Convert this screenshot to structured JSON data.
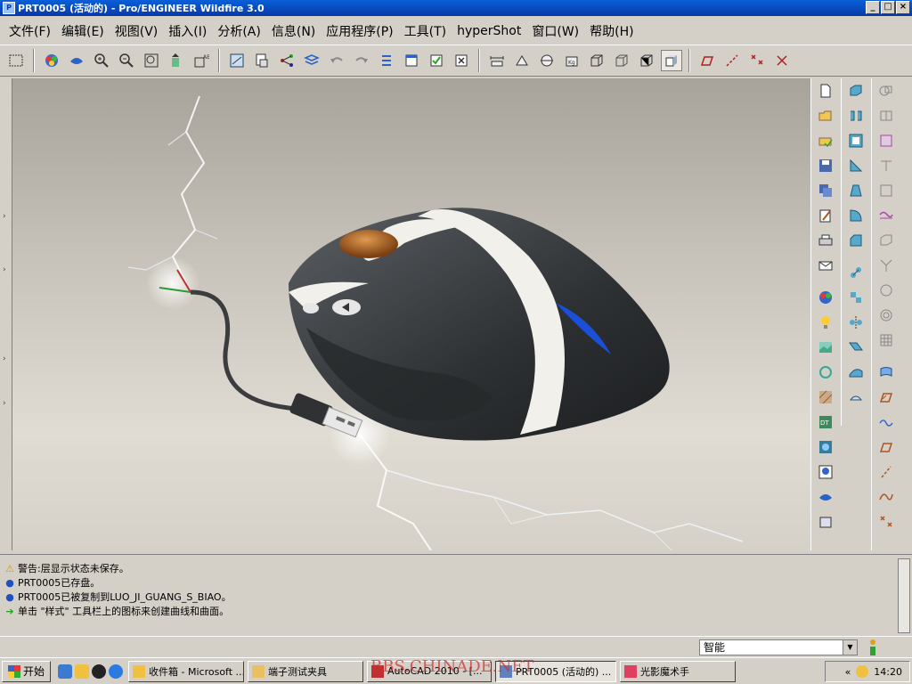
{
  "window": {
    "title": "PRT0005 (活动的) - Pro/ENGINEER Wildfire 3.0",
    "controls": [
      "_",
      "□",
      "×"
    ]
  },
  "menu": [
    "文件(F)",
    "编辑(E)",
    "视图(V)",
    "插入(I)",
    "分析(A)",
    "信息(N)",
    "应用程序(P)",
    "工具(T)",
    "hyperShot",
    "窗口(W)",
    "帮助(H)"
  ],
  "messages": [
    {
      "icon": "warning-icon",
      "text": "警告:层显示状态未保存。"
    },
    {
      "icon": "bullet-icon",
      "text": "PRT0005已存盘。"
    },
    {
      "icon": "bullet-icon",
      "text": "PRT0005已被复制到LUO_JI_GUANG_S_BIAO。"
    },
    {
      "icon": "arrow-right-icon",
      "text": "单击 \"样式\" 工具栏上的图标来创建曲线和曲面。"
    }
  ],
  "status": {
    "filter_value": "智能"
  },
  "taskbar": {
    "start_label": "开始",
    "tasks": [
      {
        "label": "收件箱 - Microsoft ...",
        "color": "#f0c040",
        "active": false
      },
      {
        "label": "端子测试夹具",
        "color": "#e8c060",
        "active": false
      },
      {
        "label": "AutoCAD 2010 - [...",
        "color": "#c03030",
        "active": false
      },
      {
        "label": "PRT0005 (活动的) ...",
        "color": "#6080c0",
        "active": true
      },
      {
        "label": "光影魔术手",
        "color": "#e04060",
        "active": false
      }
    ],
    "clock": "14:20"
  },
  "watermark": "BBS.CHINADE.NET",
  "colors": {
    "titlebar": "#0839a8",
    "ui_gray": "#d4d0c8",
    "mouse_body": "#3a3d40",
    "mouse_stripe": "#f2f0ea",
    "trackball": "#b86a20",
    "accent_blue": "#1a4fd8"
  }
}
